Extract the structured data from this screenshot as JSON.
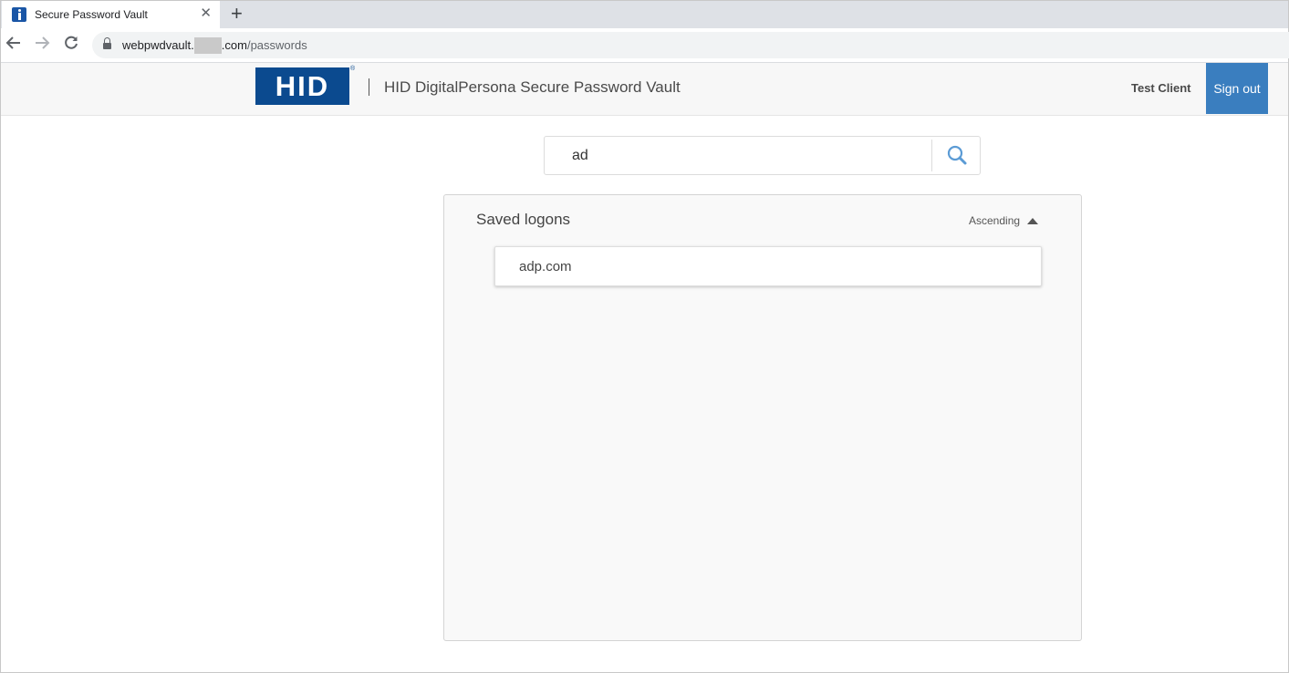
{
  "browser": {
    "tab_title": "Secure Password Vault",
    "tab_close": "✕",
    "new_tab": "+",
    "url_host_prefix": "webpwdvault.",
    "url_host_suffix": ".com",
    "url_path": "/passwords"
  },
  "header": {
    "logo_text": "HID",
    "logo_reg": "®",
    "app_title": "HID DigitalPersona Secure Password Vault",
    "user_name": "Test Client",
    "signout_label": "Sign out"
  },
  "search": {
    "value": "ad"
  },
  "saved_logons": {
    "title": "Saved logons",
    "sort_label": "Ascending",
    "items": [
      {
        "label": "adp.com"
      }
    ]
  },
  "colors": {
    "brand_blue": "#0b4a8f",
    "signout_blue": "#3a7ebf"
  }
}
